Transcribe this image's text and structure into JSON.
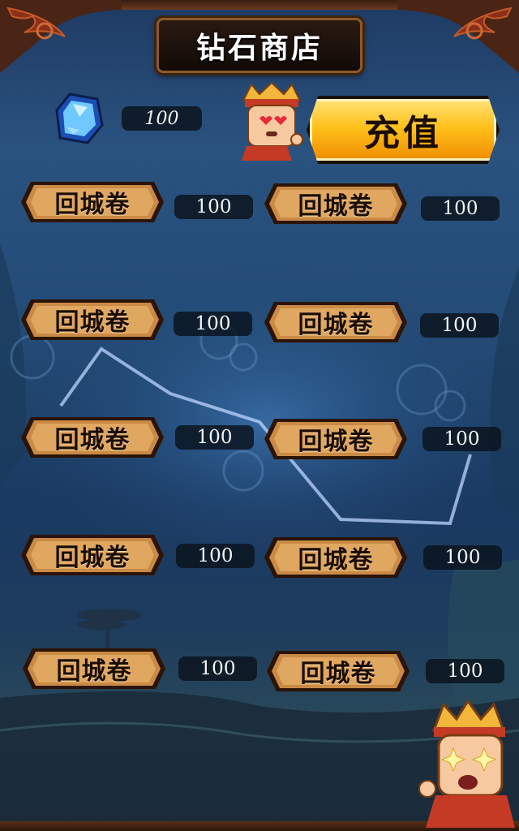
{
  "header": {
    "title": "钻石商店"
  },
  "balance": {
    "value": "100",
    "icon": "diamond-icon"
  },
  "recharge": {
    "label": "充值"
  },
  "shop": {
    "items": [
      {
        "label": "回城卷",
        "price": "100"
      },
      {
        "label": "回城卷",
        "price": "100"
      },
      {
        "label": "回城卷",
        "price": "100"
      },
      {
        "label": "回城卷",
        "price": "100"
      },
      {
        "label": "回城卷",
        "price": "100"
      },
      {
        "label": "回城卷",
        "price": "100"
      },
      {
        "label": "回城卷",
        "price": "100"
      },
      {
        "label": "回城卷",
        "price": "100"
      },
      {
        "label": "回城卷",
        "price": "100"
      },
      {
        "label": "回城卷",
        "price": "100"
      }
    ]
  },
  "colors": {
    "accent_gold": "#ffc21c",
    "button_bronze": "#c98a45",
    "background_blue": "#234b76"
  }
}
